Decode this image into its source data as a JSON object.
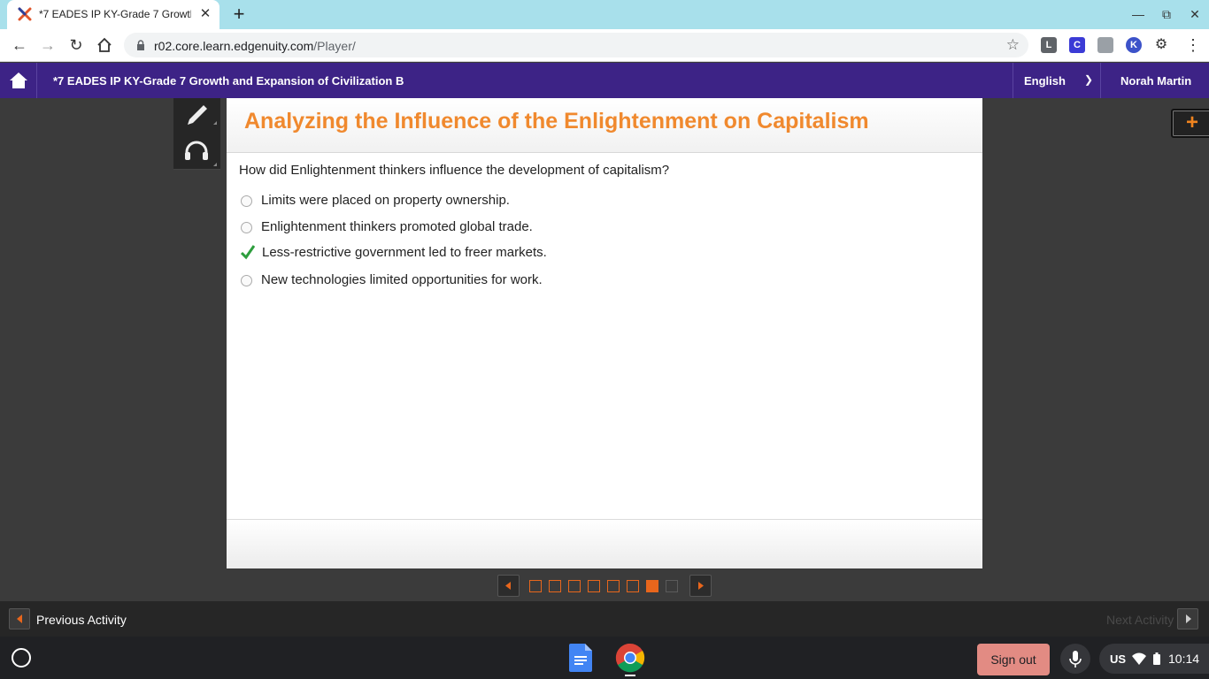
{
  "browser": {
    "tab_title": "*7 EADES IP KY-Grade 7 Growth and Expansion of Civilization B",
    "url_host": "r02.core.learn.edgenuity.com",
    "url_path": "/Player/",
    "extensions": [
      {
        "name": "L",
        "color": "#5f6368"
      },
      {
        "name": "C",
        "color": "#3b3bd6"
      },
      {
        "name": "",
        "color": "#9aa0a6"
      },
      {
        "name": "K",
        "color": "#3c52c9"
      }
    ]
  },
  "header": {
    "course_title": "*7 EADES IP KY-Grade 7 Growth and Expansion of Civilization B",
    "language": "English",
    "user_name": "Norah Martin"
  },
  "lesson": {
    "title": "Analyzing the Influence of the Enlightenment on Capitalism",
    "question": "How did Enlightenment thinkers influence the development of capitalism?",
    "options": [
      {
        "text": "Limits were placed on property ownership.",
        "selected": false
      },
      {
        "text": "Enlightenment thinkers promoted global trade.",
        "selected": false
      },
      {
        "text": "Less-restrictive government led to freer markets.",
        "selected": true
      },
      {
        "text": "New technologies limited opportunities for work.",
        "selected": false
      }
    ]
  },
  "pager": {
    "total_pages": 8,
    "current_page": 7,
    "accent_color": "#e8661c"
  },
  "activity_nav": {
    "previous_label": "Previous Activity",
    "next_label": "Next Activity"
  },
  "shelf": {
    "sign_out_label": "Sign out",
    "locale": "US",
    "time": "10:14"
  },
  "colors": {
    "header_purple": "#3d2386",
    "title_orange": "#f0892e",
    "check_green": "#2e9e3e"
  }
}
